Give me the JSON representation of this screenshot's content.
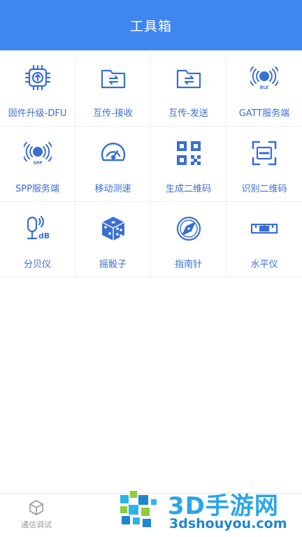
{
  "header": {
    "title": "工具箱"
  },
  "tools": [
    {
      "label": "固件升级-DFU",
      "icon": "chip-upload-icon"
    },
    {
      "label": "互传-接收",
      "icon": "folder-receive-icon"
    },
    {
      "label": "互传-发送",
      "icon": "folder-send-icon"
    },
    {
      "label": "GATT服务端",
      "icon": "ble-signal-icon"
    },
    {
      "label": "SPP服务端",
      "icon": "spp-signal-icon"
    },
    {
      "label": "移动测速",
      "icon": "speedometer-icon"
    },
    {
      "label": "生成二维码",
      "icon": "qr-code-icon"
    },
    {
      "label": "识别二维码",
      "icon": "qr-scan-icon"
    },
    {
      "label": "分贝仪",
      "icon": "microphone-db-icon"
    },
    {
      "label": "摇骰子",
      "icon": "dice-icon"
    },
    {
      "label": "指南针",
      "icon": "compass-icon"
    },
    {
      "label": "水平仪",
      "icon": "spirit-level-icon"
    }
  ],
  "tabbar": {
    "tab_label": "通信调试",
    "tab_icon": "cube-icon"
  },
  "watermark": {
    "name": "3D手游网",
    "site": "3dshouyou.com"
  },
  "colors": {
    "header": "#3f86f1",
    "accent": "#3a6fd0",
    "tab_inactive": "#9a9a9a",
    "watermark": "#2aa5e8"
  }
}
